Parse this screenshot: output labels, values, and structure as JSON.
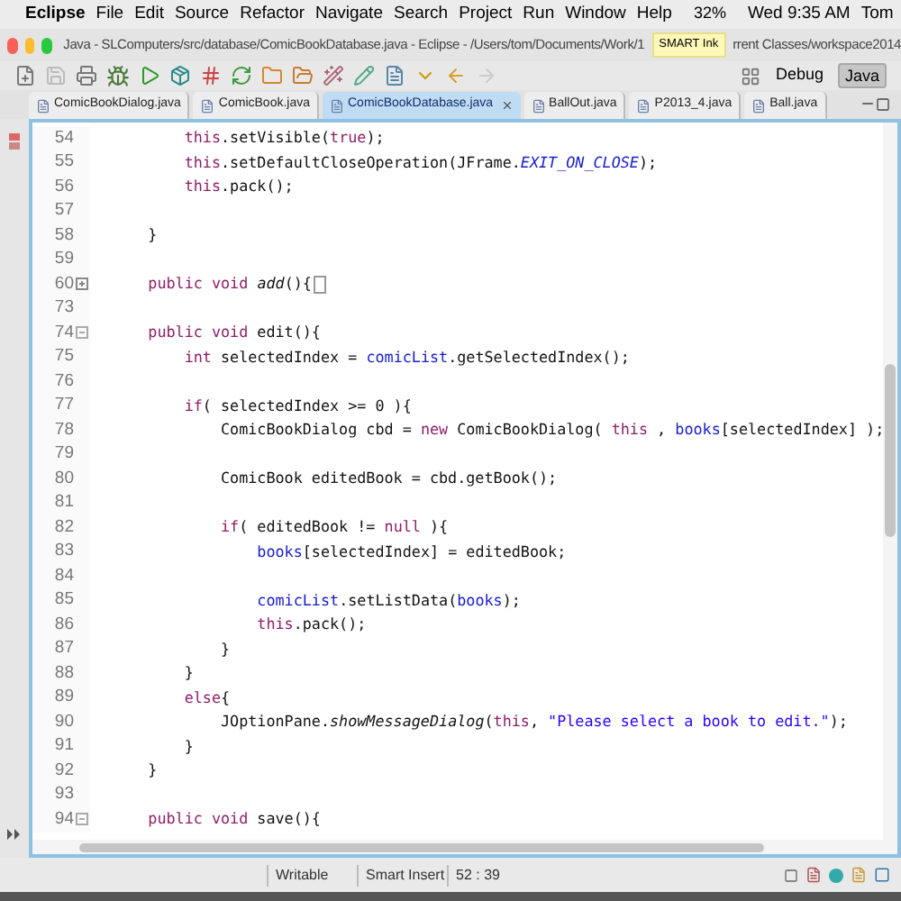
{
  "menu_bar": {
    "app": "Eclipse",
    "items": [
      "File",
      "Edit",
      "Source",
      "Refactor",
      "Navigate",
      "Search",
      "Project",
      "Run",
      "Window",
      "Help"
    ],
    "battery": "32%",
    "clock": "Wed 9:35 AM",
    "user": "Tom"
  },
  "window": {
    "title_start": "Java - SLComputers/src/database/ComicBookDatabase.java - Eclipse - /Users/tom/Documents/Work/1",
    "tooltip": "SMART Ink",
    "title_end": "rrent Classes/workspace2014"
  },
  "perspectives": [
    {
      "label": "Debug",
      "selected": false
    },
    {
      "label": "Java",
      "selected": true
    }
  ],
  "tabs": [
    {
      "label": "ComicBookDialog.java",
      "selected": false
    },
    {
      "label": "ComicBook.java",
      "selected": false
    },
    {
      "label": "ComicBookDatabase.java",
      "selected": true
    },
    {
      "label": "BallOut.java",
      "selected": false
    },
    {
      "label": "P2013_4.java",
      "selected": false
    },
    {
      "label": "Ball.java",
      "selected": false
    }
  ],
  "code_lines": [
    {
      "number": "54",
      "segments": [
        {
          "text": "        this",
          "kind": "keyword"
        },
        {
          "text": ".setVisible(",
          "kind": "plain"
        },
        {
          "text": "true",
          "kind": "keyword"
        },
        {
          "text": ");",
          "kind": "plain"
        }
      ]
    },
    {
      "number": "55",
      "segments": [
        {
          "text": "        this",
          "kind": "keyword"
        },
        {
          "text": ".setDefaultCloseOperation(JFrame.",
          "kind": "plain"
        },
        {
          "text": "EXIT_ON_CLOSE",
          "kind": "static"
        },
        {
          "text": ");",
          "kind": "plain"
        }
      ]
    },
    {
      "number": "56",
      "segments": [
        {
          "text": "        this",
          "kind": "keyword"
        },
        {
          "text": ".pack();",
          "kind": "plain"
        }
      ]
    },
    {
      "number": "57"
    },
    {
      "number": "58",
      "segments": [
        {
          "text": "    }",
          "kind": "plain"
        }
      ]
    },
    {
      "number": "59"
    },
    {
      "number": "60",
      "folded": true,
      "segments": [
        {
          "text": "    public void ",
          "kind": "keyword"
        },
        {
          "text": "add",
          "kind": "italic"
        },
        {
          "text": "(){",
          "kind": "plain"
        }
      ]
    },
    {
      "number": "73"
    },
    {
      "number": "74",
      "folded": false,
      "segments": [
        {
          "text": "    public void",
          "kind": "keyword"
        },
        {
          "text": " edit(){",
          "kind": "plain"
        }
      ]
    },
    {
      "number": "75",
      "segments": [
        {
          "text": "        int",
          "kind": "keyword"
        },
        {
          "text": " selectedIndex = ",
          "kind": "plain"
        },
        {
          "text": "comicList",
          "kind": "field"
        },
        {
          "text": ".getSelectedIndex();",
          "kind": "plain"
        }
      ]
    },
    {
      "number": "76"
    },
    {
      "number": "77",
      "segments": [
        {
          "text": "        if",
          "kind": "keyword"
        },
        {
          "text": "( selectedIndex >= 0 ){",
          "kind": "plain"
        }
      ]
    },
    {
      "number": "78",
      "segments": [
        {
          "text": "            ComicBookDialog cbd = ",
          "kind": "plain"
        },
        {
          "text": "new",
          "kind": "keyword"
        },
        {
          "text": " ComicBookDialog( ",
          "kind": "plain"
        },
        {
          "text": "this",
          "kind": "keyword"
        },
        {
          "text": " , ",
          "kind": "plain"
        },
        {
          "text": "books",
          "kind": "field"
        },
        {
          "text": "[selectedIndex] );",
          "kind": "plain"
        }
      ]
    },
    {
      "number": "79"
    },
    {
      "number": "80",
      "segments": [
        {
          "text": "            ComicBook editedBook = cbd.getBook();",
          "kind": "plain"
        }
      ]
    },
    {
      "number": "81"
    },
    {
      "number": "82",
      "segments": [
        {
          "text": "            if",
          "kind": "keyword"
        },
        {
          "text": "( editedBook != ",
          "kind": "plain"
        },
        {
          "text": "null",
          "kind": "keyword"
        },
        {
          "text": " ){",
          "kind": "plain"
        }
      ]
    },
    {
      "number": "83",
      "segments": [
        {
          "text": "                books",
          "kind": "field"
        },
        {
          "text": "[selectedIndex] = editedBook;",
          "kind": "plain"
        }
      ]
    },
    {
      "number": "84"
    },
    {
      "number": "85",
      "segments": [
        {
          "text": "                comicList",
          "kind": "field"
        },
        {
          "text": ".setListData(",
          "kind": "plain"
        },
        {
          "text": "books",
          "kind": "field"
        },
        {
          "text": ");",
          "kind": "plain"
        }
      ]
    },
    {
      "number": "86",
      "segments": [
        {
          "text": "                this",
          "kind": "keyword"
        },
        {
          "text": ".pack();",
          "kind": "plain"
        }
      ]
    },
    {
      "number": "87",
      "segments": [
        {
          "text": "            }",
          "kind": "plain"
        }
      ]
    },
    {
      "number": "88",
      "segments": [
        {
          "text": "        }",
          "kind": "plain"
        }
      ]
    },
    {
      "number": "89",
      "segments": [
        {
          "text": "        else",
          "kind": "keyword"
        },
        {
          "text": "{",
          "kind": "plain"
        }
      ]
    },
    {
      "number": "90",
      "segments": [
        {
          "text": "            JOptionPane.",
          "kind": "plain"
        },
        {
          "text": "showMessageDialog",
          "kind": "italic"
        },
        {
          "text": "(",
          "kind": "plain"
        },
        {
          "text": "this",
          "kind": "keyword"
        },
        {
          "text": ", ",
          "kind": "plain"
        },
        {
          "text": "\"Please select a book to edit.\"",
          "kind": "string"
        },
        {
          "text": ");",
          "kind": "plain"
        }
      ]
    },
    {
      "number": "91",
      "segments": [
        {
          "text": "        }",
          "kind": "plain"
        }
      ]
    },
    {
      "number": "92",
      "segments": [
        {
          "text": "    }",
          "kind": "plain"
        }
      ]
    },
    {
      "number": "93"
    },
    {
      "number": "94",
      "folded": false,
      "segments": [
        {
          "text": "    public void",
          "kind": "keyword"
        },
        {
          "text": " save(){",
          "kind": "plain"
        }
      ]
    }
  ],
  "status_bar": [
    "Writable",
    "Smart Insert",
    "52 : 39"
  ]
}
